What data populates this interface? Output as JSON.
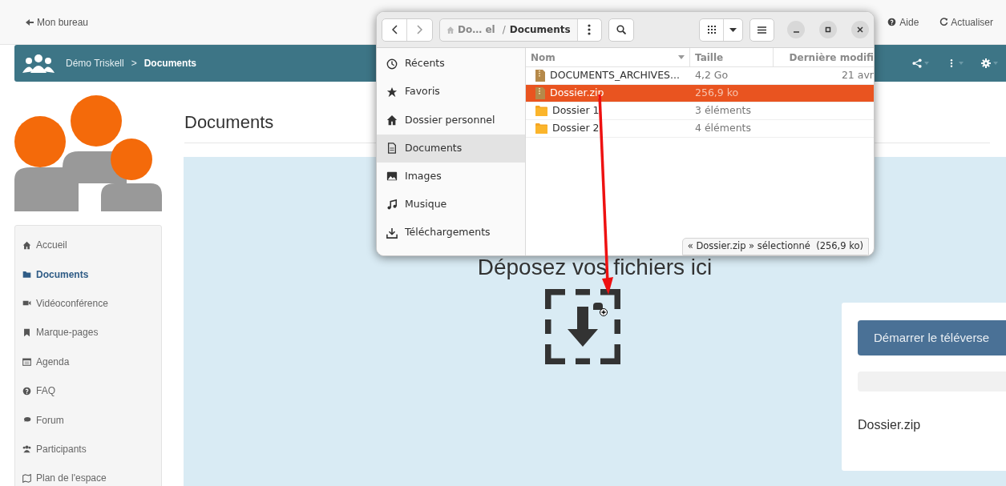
{
  "topbar": {
    "back_link": "Mon bureau",
    "help_link": "Aide",
    "refresh_link": "Actualiser"
  },
  "breadcrumb": {
    "space": "Démo Triskell",
    "separator": ">",
    "current": "Documents"
  },
  "nav": [
    {
      "kind": "home",
      "label": "Accueil",
      "selected": false
    },
    {
      "kind": "folder",
      "label": "Documents",
      "selected": true
    },
    {
      "kind": "video",
      "label": "Vidéoconférence",
      "selected": false
    },
    {
      "kind": "bookmark",
      "label": "Marque-pages",
      "selected": false
    },
    {
      "kind": "calendar",
      "label": "Agenda",
      "selected": false
    },
    {
      "kind": "question",
      "label": "FAQ",
      "selected": false
    },
    {
      "kind": "chat",
      "label": "Forum",
      "selected": false
    },
    {
      "kind": "users",
      "label": "Participants",
      "selected": false
    },
    {
      "kind": "map",
      "label": "Plan de l'espace",
      "selected": false
    }
  ],
  "page_title": "Documents",
  "dropzone": {
    "message": "Déposez vos fichiers ici"
  },
  "upload_panel": {
    "start_button": "Démarrer le téléverse",
    "progress": {
      "level": 0
    },
    "file_name": "Dossier.zip"
  },
  "file_dialog": {
    "path": {
      "home_segment": "Do… el",
      "separator": "/",
      "current": "Documents"
    },
    "places": [
      {
        "kind": "clock",
        "label": "Récents",
        "selected": false
      },
      {
        "kind": "star",
        "label": "Favoris",
        "selected": false
      },
      {
        "kind": "home",
        "label": "Dossier personnel",
        "selected": false
      },
      {
        "kind": "document",
        "label": "Documents",
        "selected": true
      },
      {
        "kind": "image",
        "label": "Images",
        "selected": false
      },
      {
        "kind": "music",
        "label": "Musique",
        "selected": false
      },
      {
        "kind": "download",
        "label": "Téléchargements",
        "selected": false
      }
    ],
    "columns": [
      "Nom",
      "Taille",
      "Dernière modifi"
    ],
    "files": [
      {
        "kind": "archive",
        "name": "DOCUMENTS_ARCHIVES...",
        "size": "4,2 Go",
        "modified": "21 avr",
        "selected": false
      },
      {
        "kind": "archive",
        "name": "Dossier.zip",
        "size": "256,9 ko",
        "selected": true
      },
      {
        "kind": "folder",
        "name": "Dossier 1",
        "size": "3 éléments",
        "selected": false
      },
      {
        "kind": "folder",
        "name": "Dossier 2",
        "size": "4 éléments",
        "selected": false
      }
    ],
    "status": "« Dossier.zip » sélectionné  (256,9 ko)"
  }
}
